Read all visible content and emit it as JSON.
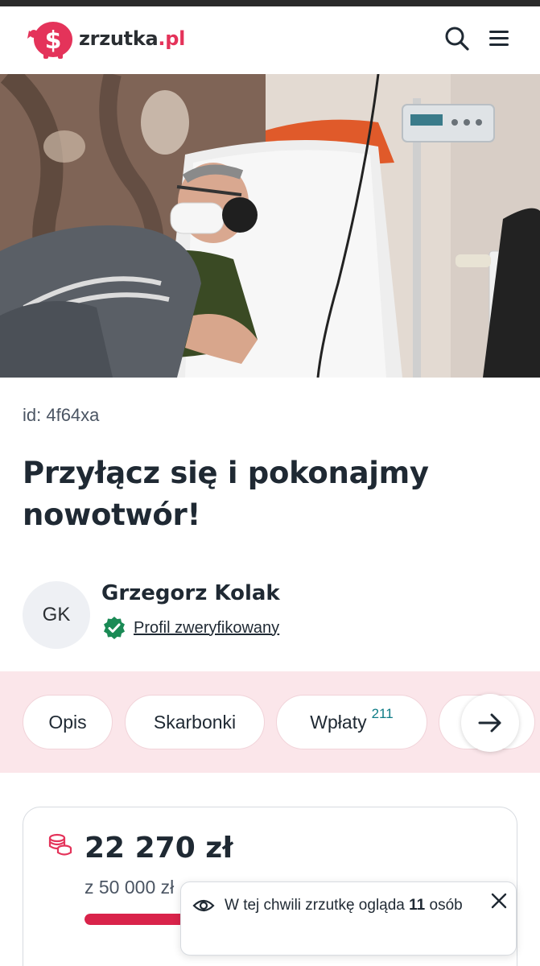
{
  "header": {
    "logo_text": "zrzutka",
    "logo_tld": ".pl"
  },
  "fundraiser": {
    "id_label": "id: 4f64xa",
    "title": "Przyłącz się i pokonajmy nowotwór!",
    "author": {
      "initials": "GK",
      "name": "Grzegorz Kolak",
      "verified_label": "Profil zweryfikowany"
    }
  },
  "tabs": [
    {
      "label": "Opis"
    },
    {
      "label": "Skarbonki"
    },
    {
      "label": "Wpłaty",
      "badge": "211"
    }
  ],
  "stats": {
    "amount": "22 270 zł",
    "target": "z 50 000 zł",
    "progress_percent": 44.5
  },
  "toast": {
    "text_before": "W tej chwili zrzutkę ogląda",
    "count": "11",
    "text_after": "osób"
  },
  "colors": {
    "brand": "#e4335a",
    "progress": "#d9234a",
    "tabs_band": "#fbe6ea",
    "verified": "#1a8a55",
    "badge": "#0e7c86"
  },
  "icons": {
    "search": "search-icon",
    "menu": "hamburger-menu-icon",
    "verified": "verified-badge-icon",
    "next": "arrow-right-icon",
    "coins": "coins-icon",
    "views": "eye-icon",
    "close": "close-icon"
  }
}
